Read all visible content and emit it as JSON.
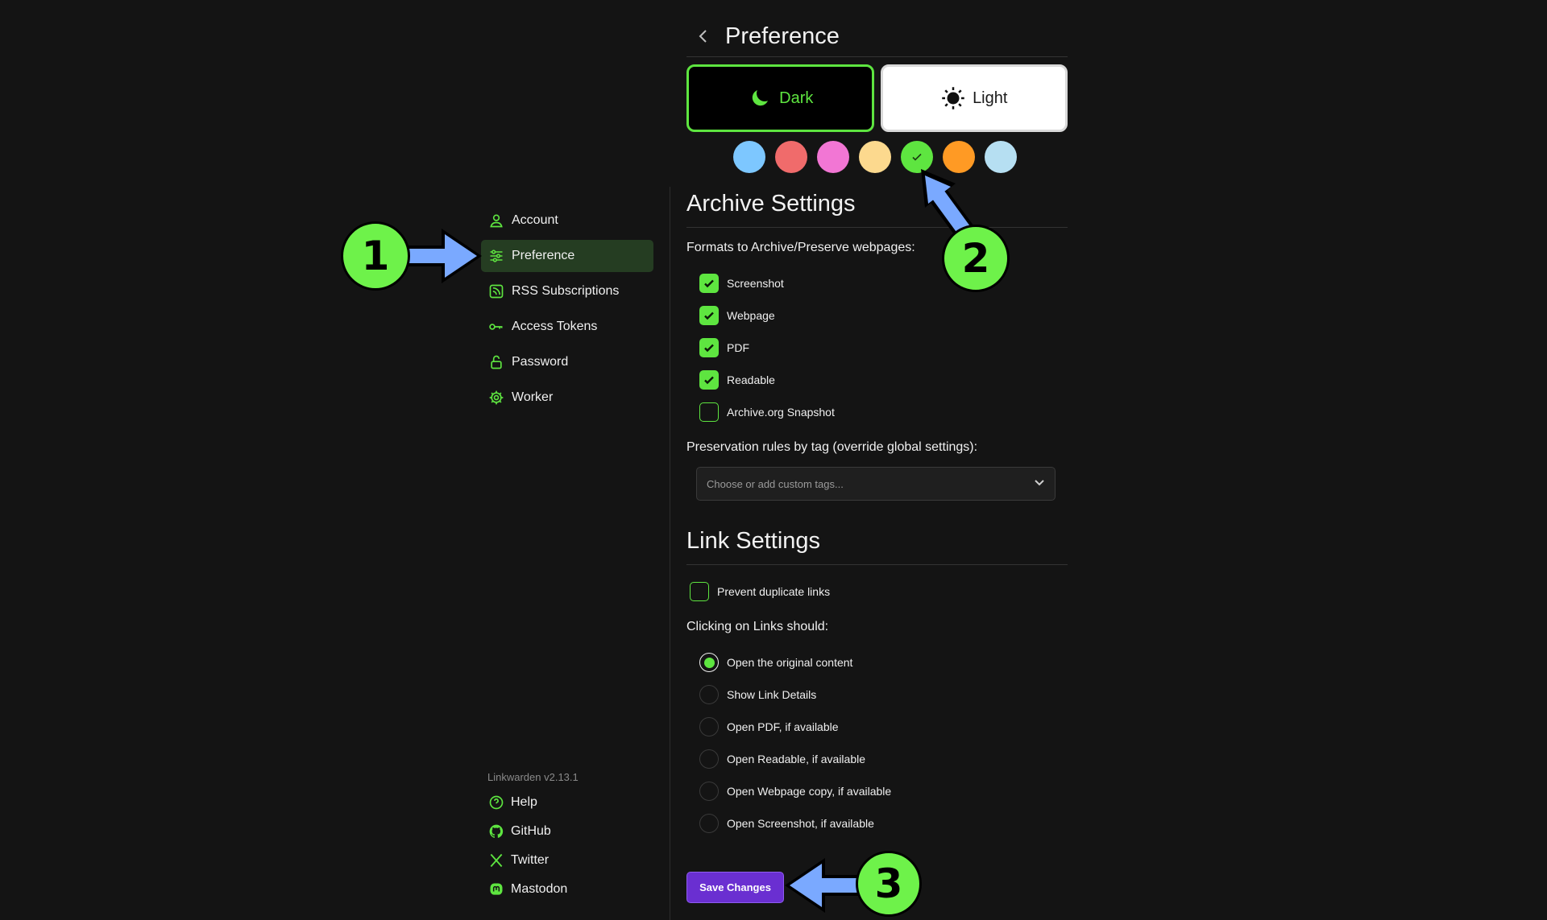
{
  "colors": {
    "accent": "#5ee540",
    "active_bg": "#253d22",
    "save_button": "#6a2fd1",
    "annotation_badge": "#6ef24a",
    "annotation_arrow": "#7aa9ff",
    "swatches": [
      "#7dc7ff",
      "#f06b6b",
      "#f276d4",
      "#fcd98e",
      "#5ee540",
      "#ff9a24",
      "#b6dff2"
    ]
  },
  "header": {
    "title": "Preference",
    "back_icon": "chevron-left-icon"
  },
  "theme": {
    "dark_label": "Dark",
    "light_label": "Light",
    "selected": "Dark",
    "selected_swatch_index": 4
  },
  "sidebar": {
    "items": [
      {
        "label": "Account",
        "icon": "user-icon"
      },
      {
        "label": "Preference",
        "icon": "sliders-icon",
        "active": true
      },
      {
        "label": "RSS Subscriptions",
        "icon": "rss-icon"
      },
      {
        "label": "Access Tokens",
        "icon": "key-icon"
      },
      {
        "label": "Password",
        "icon": "lock-icon"
      },
      {
        "label": "Worker",
        "icon": "gear-icon"
      }
    ],
    "version": "Linkwarden v2.13.1",
    "footer_links": [
      {
        "label": "Help",
        "icon": "help-icon"
      },
      {
        "label": "GitHub",
        "icon": "github-icon"
      },
      {
        "label": "Twitter",
        "icon": "x-icon"
      },
      {
        "label": "Mastodon",
        "icon": "mastodon-icon"
      }
    ]
  },
  "archive": {
    "title": "Archive Settings",
    "formats_label": "Formats to Archive/Preserve webpages:",
    "formats": [
      {
        "label": "Screenshot",
        "checked": true
      },
      {
        "label": "Webpage",
        "checked": true
      },
      {
        "label": "PDF",
        "checked": true
      },
      {
        "label": "Readable",
        "checked": true
      },
      {
        "label": "Archive.org Snapshot",
        "checked": false
      }
    ],
    "rules_label": "Preservation rules by tag (override global settings):",
    "tags_placeholder": "Choose or add custom tags..."
  },
  "links": {
    "title": "Link Settings",
    "prevent_duplicates": {
      "label": "Prevent duplicate links",
      "checked": false
    },
    "click_label": "Clicking on Links should:",
    "options": [
      {
        "label": "Open the original content",
        "selected": true
      },
      {
        "label": "Show Link Details",
        "selected": false
      },
      {
        "label": "Open PDF, if available",
        "selected": false
      },
      {
        "label": "Open Readable, if available",
        "selected": false
      },
      {
        "label": "Open Webpage copy, if available",
        "selected": false
      },
      {
        "label": "Open Screenshot, if available",
        "selected": false
      }
    ]
  },
  "save_label": "Save Changes",
  "annotations": [
    "1",
    "2",
    "3"
  ]
}
